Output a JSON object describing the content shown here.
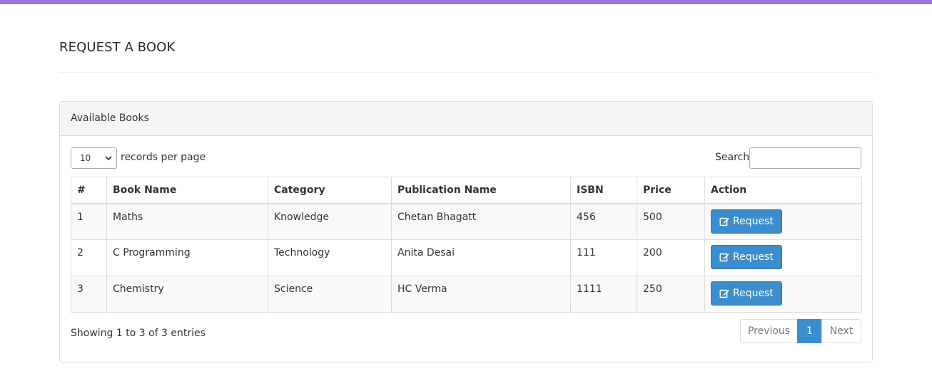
{
  "page": {
    "title": "REQUEST A BOOK"
  },
  "panel": {
    "heading": "Available Books"
  },
  "length": {
    "value": "10",
    "label": "records per page"
  },
  "search": {
    "label": "Search:",
    "value": ""
  },
  "table": {
    "headers": [
      "#",
      "Book Name",
      "Category",
      "Publication Name",
      "ISBN",
      "Price",
      "Action"
    ],
    "rows": [
      {
        "num": "1",
        "book": "Maths",
        "category": "Knowledge",
        "publication": "Chetan Bhagatt",
        "isbn": "456",
        "price": "500",
        "action": "Request"
      },
      {
        "num": "2",
        "book": "C Programming",
        "category": "Technology",
        "publication": "Anita Desai",
        "isbn": "111",
        "price": "200",
        "action": "Request"
      },
      {
        "num": "3",
        "book": "Chemistry",
        "category": "Science",
        "publication": "HC Verma",
        "isbn": "1111",
        "price": "250",
        "action": "Request"
      }
    ]
  },
  "info": "Showing 1 to 3 of 3 entries",
  "pagination": {
    "previous": "Previous",
    "current": "1",
    "next": "Next"
  },
  "icons": {
    "request": "edit-icon",
    "select": "chevron-down-icon"
  },
  "colors": {
    "accent_bar": "#9b74d8",
    "primary": "#3c8dcd"
  }
}
